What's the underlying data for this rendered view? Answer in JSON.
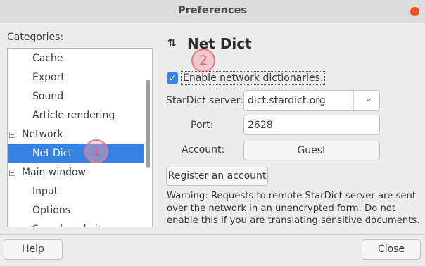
{
  "window": {
    "title": "Preferences"
  },
  "categories": {
    "label": "Categories:",
    "items": [
      {
        "label": "Cache",
        "level": "child"
      },
      {
        "label": "Export",
        "level": "child"
      },
      {
        "label": "Sound",
        "level": "child"
      },
      {
        "label": "Article rendering",
        "level": "child"
      },
      {
        "label": "Network",
        "level": "parent",
        "expanded": true
      },
      {
        "label": "Net Dict",
        "level": "child",
        "selected": true
      },
      {
        "label": "Main window",
        "level": "parent",
        "expanded": true
      },
      {
        "label": "Input",
        "level": "child"
      },
      {
        "label": "Options",
        "level": "child"
      },
      {
        "label": "Search website",
        "level": "child"
      }
    ]
  },
  "markers": {
    "marker1": "1",
    "marker2": "2"
  },
  "panel": {
    "heading_icon": "⇅",
    "heading": "Net Dict",
    "enable_checkbox": {
      "label": "Enable network dictionaries.",
      "checked": true
    },
    "server": {
      "label": "StarDict server:",
      "value": "dict.stardict.org"
    },
    "port": {
      "label": "Port:",
      "value": "2628"
    },
    "account": {
      "label": "Account:",
      "button": "Guest"
    },
    "register_button": "Register an account",
    "warning": "Warning: Requests to remote StarDict server are sent over the network in an unencrypted form. Do not enable this if you are translating sensitive documents."
  },
  "footer": {
    "help": "Help",
    "close": "Close"
  },
  "colors": {
    "selection": "#3584e4",
    "close_dot": "#e95420",
    "marker": "#e47a86"
  }
}
